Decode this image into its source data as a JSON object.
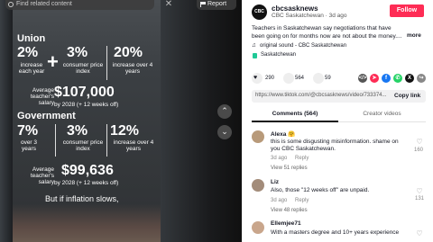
{
  "video": {
    "search_placeholder": "Find related content",
    "report_label": "Report",
    "close_symbol": "✕",
    "up_symbol": "⌃",
    "down_symbol": "⌄",
    "union": {
      "title": "Union",
      "stat1_value": "2%",
      "stat1_caption": "increase each year",
      "stat2_value": "3%",
      "stat2_caption": "consumer price index",
      "stat3_value": "20%",
      "stat3_caption": "increase over 4 years",
      "salary_caption": "Average teacher's salary",
      "salary_value": "$107,000",
      "salary_note": "by 2028 (+ 12 weeks off)"
    },
    "government": {
      "title": "Government",
      "stat1_value": "7%",
      "stat1_caption": "over 3 years",
      "stat2_value": "3%",
      "stat2_caption": "consumer price index",
      "stat3_value": "12%",
      "stat3_caption": "increase over 4 years",
      "salary_caption": "Average teacher's salary",
      "salary_value": "$99,636",
      "salary_note": "by 2028 (+ 12 weeks off)"
    },
    "subtitle": "But if inflation slows,"
  },
  "panel": {
    "avatar_text": "CBC",
    "username": "cbcsasknews",
    "display_name": "CBC Saskatchewan",
    "separator": "·",
    "age": "3d ago",
    "follow_label": "Follow",
    "description": "Teachers in Saskatchewan say negotiations that have been going on for months now are not about the money....",
    "more_label": "more",
    "sound": "original sound - CBC Saskatchewan",
    "location": "Saskatchewan",
    "likes": "290",
    "comments_count": "564",
    "saves": "59",
    "url": "https://www.tiktok.com/@cbcsasknews/video/733374...",
    "copy_link_label": "Copy link",
    "tab_comments": "Comments (564)",
    "tab_creator_videos": "Creator videos",
    "reply_label": "Reply",
    "comments": [
      {
        "author": "Alexa 🤗",
        "text": "this is some disgusting misinformation. shame on you CBC Saskatchewan.",
        "age": "3d ago",
        "likes": "160",
        "replies": "View 51 replies"
      },
      {
        "author": "Liz",
        "text": "Also, those \"12 weeks off\" are unpaid.",
        "age": "3d ago",
        "likes": "131",
        "replies": "View 48 replies"
      },
      {
        "author": "Ellemjee71",
        "text": "With a masters degree and 10+ years experience",
        "age": "",
        "likes": "",
        "replies": ""
      }
    ]
  },
  "colors": {
    "follow": "#fe2c55",
    "video_bg": "#121212"
  },
  "icons": [
    "search-icon",
    "report-flag-icon",
    "close-icon",
    "chevron-up-icon",
    "chevron-down-icon",
    "heart-icon",
    "comment-icon",
    "bookmark-icon",
    "music-icon",
    "location-pin-icon",
    "embed-icon",
    "share-icon"
  ]
}
